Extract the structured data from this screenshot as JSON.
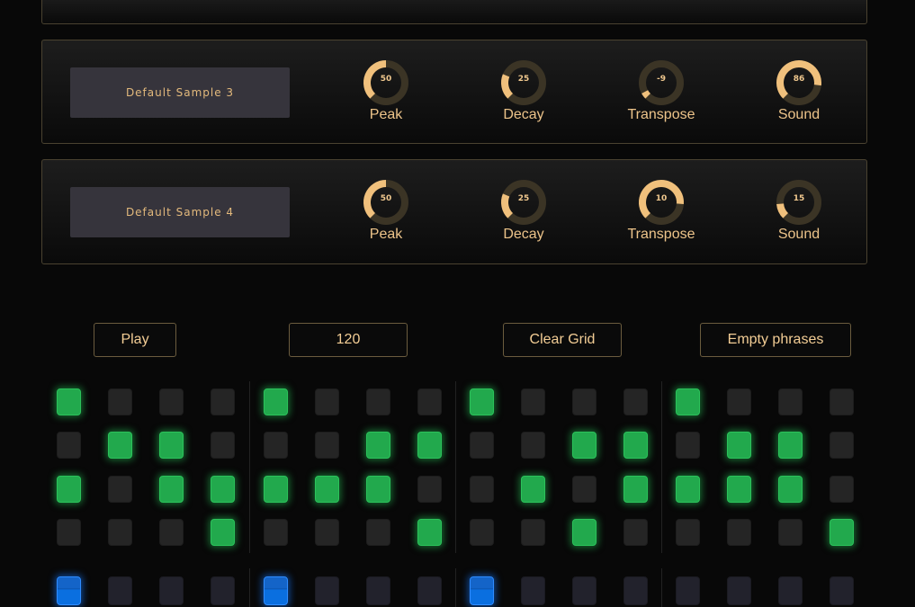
{
  "samples": [
    {
      "name": "Default Sample 3",
      "knobs": [
        {
          "label": "Peak",
          "value": "50",
          "level": 0.5
        },
        {
          "label": "Decay",
          "value": "25",
          "level": 0.25
        },
        {
          "label": "Transpose",
          "value": "-9",
          "level": 0.06
        },
        {
          "label": "Sound",
          "value": "86",
          "level": 0.86
        }
      ]
    },
    {
      "name": "Default Sample 4",
      "knobs": [
        {
          "label": "Peak",
          "value": "50",
          "level": 0.5
        },
        {
          "label": "Decay",
          "value": "25",
          "level": 0.25
        },
        {
          "label": "Transpose",
          "value": "10",
          "level": 0.85
        },
        {
          "label": "Sound",
          "value": "15",
          "level": 0.15
        }
      ]
    }
  ],
  "controls": {
    "play": "Play",
    "tempo": "120",
    "clear_grid": "Clear Grid",
    "empty_phrases": "Empty phrases"
  },
  "grid": {
    "rows": [
      [
        1,
        0,
        0,
        0,
        1,
        0,
        0,
        0,
        1,
        0,
        0,
        0,
        1,
        0,
        0,
        0
      ],
      [
        0,
        1,
        1,
        0,
        0,
        0,
        1,
        1,
        0,
        0,
        1,
        1,
        0,
        1,
        1,
        0
      ],
      [
        1,
        0,
        1,
        1,
        1,
        1,
        1,
        0,
        0,
        1,
        0,
        1,
        1,
        1,
        1,
        0
      ],
      [
        0,
        0,
        0,
        1,
        0,
        0,
        0,
        1,
        0,
        0,
        1,
        0,
        0,
        0,
        0,
        1
      ]
    ],
    "playhead_row": [
      1,
      0,
      0,
      0,
      1,
      0,
      0,
      0,
      1,
      0,
      0,
      0,
      0,
      0,
      0,
      0
    ]
  },
  "colors": {
    "accent": "#f0c07c",
    "step_on": "#22a94d",
    "step_off": "#252525",
    "playhead": "#0a6fe0"
  }
}
